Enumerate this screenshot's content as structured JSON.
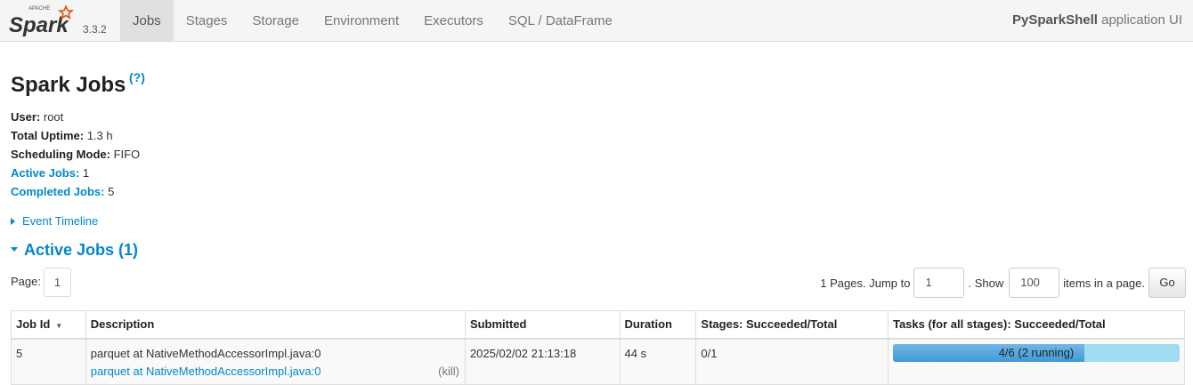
{
  "brand": {
    "apache": "APACHE",
    "logo_text": "Spark",
    "version": "3.3.2"
  },
  "nav": {
    "tabs": [
      {
        "label": "Jobs",
        "active": true
      },
      {
        "label": "Stages"
      },
      {
        "label": "Storage"
      },
      {
        "label": "Environment"
      },
      {
        "label": "Executors"
      },
      {
        "label": "SQL / DataFrame"
      }
    ],
    "app_name_bold": "PySparkShell",
    "app_name_suffix": " application UI"
  },
  "page": {
    "title": "Spark Jobs",
    "help": "(?)",
    "info": [
      {
        "key": "User:",
        "value": " root"
      },
      {
        "key": "Total Uptime:",
        "value": " 1.3 h"
      },
      {
        "key": "Scheduling Mode:",
        "value": " FIFO"
      },
      {
        "key": "Active Jobs:",
        "value": " 1",
        "link": true
      },
      {
        "key": "Completed Jobs:",
        "value": " 5",
        "link": true
      }
    ],
    "event_timeline": "Event Timeline",
    "active_jobs_heading": "Active Jobs (1)"
  },
  "pager": {
    "page_label": "Page:",
    "current_page": "1",
    "pages_text": "1 Pages. Jump to",
    "jump_value": "1",
    "show_text": ". Show",
    "show_value": "100",
    "items_text": "items in a page.",
    "go": "Go"
  },
  "table": {
    "headers": [
      "Job Id",
      "Description",
      "Submitted",
      "Duration",
      "Stages: Succeeded/Total",
      "Tasks (for all stages): Succeeded/Total"
    ],
    "sort_arrow": "▼",
    "rows": [
      {
        "job_id": "5",
        "description": "parquet at NativeMethodAccessorImpl.java:0",
        "description_link": "parquet at NativeMethodAccessorImpl.java:0",
        "kill": "(kill)",
        "submitted": "2025/02/02 21:13:18",
        "duration": "44 s",
        "stages": "0/1",
        "tasks_text": "4/6 (2 running)",
        "tasks_succeeded": 4,
        "tasks_total": 6
      }
    ]
  },
  "colors": {
    "link": "#0088cc",
    "progress_done": "#3e9ad8",
    "progress_running": "#a0dcf0"
  }
}
